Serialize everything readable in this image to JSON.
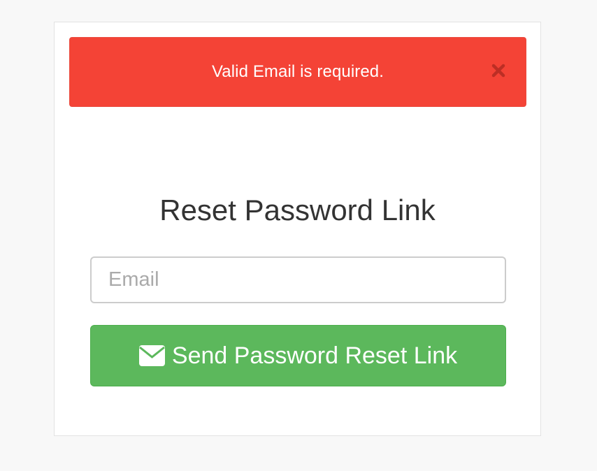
{
  "alert": {
    "message": "Valid Email is required.",
    "close_icon": "close-icon",
    "background_color": "#f44336"
  },
  "form": {
    "title": "Reset Password Link",
    "email_placeholder": "Email",
    "email_value": "",
    "submit_label": "Send Password Reset Link",
    "submit_icon": "envelope-icon",
    "submit_color": "#5cb85c"
  }
}
